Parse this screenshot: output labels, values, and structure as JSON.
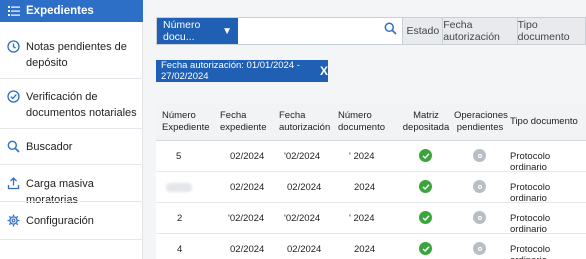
{
  "sidebar": {
    "active_label": "Expedientes",
    "items": [
      {
        "label": "Notas pendientes de depósito",
        "icon": "clock-icon"
      },
      {
        "label": "Verificación de documentos notariales",
        "icon": "check-circle-icon"
      },
      {
        "label": "Buscador",
        "icon": "search-icon"
      },
      {
        "label": "Carga masiva moratorias",
        "icon": "upload-icon"
      },
      {
        "label": "Configuración",
        "icon": "gear-icon"
      }
    ]
  },
  "filterbar": {
    "select_label": "Número docu...",
    "search_placeholder": "",
    "columns": [
      "Estado",
      "Fecha autorización",
      "Tipo documento"
    ]
  },
  "chip": {
    "label": "Fecha autorización: 01/01/2024 - 27/02/2024",
    "close": "X"
  },
  "table": {
    "headers": {
      "numero_expediente": "Número Expediente",
      "fecha_expediente": "Fecha expediente",
      "fecha_autorizacion": "Fecha autorización",
      "numero_documento": "Número documento",
      "matriz_depositada": "Matriz depositada",
      "operaciones_pendientes": "Operaciones pendientes",
      "tipo_documento": "Tipo documento"
    },
    "rows": [
      {
        "numero": "5",
        "fecha_exp": "02/2024",
        "fecha_aut": "'02/2024",
        "num_doc": "' 2024",
        "tipo": "Protocolo ordinario"
      },
      {
        "numero": "",
        "fecha_exp": "02/2024",
        "fecha_aut": "02/2024",
        "num_doc": "2024",
        "tipo": "Protocolo ordinario"
      },
      {
        "numero": "2",
        "fecha_exp": "'02/2024",
        "fecha_aut": "'02/2024",
        "num_doc": "' 2024",
        "tipo": "Protocolo ordinario"
      },
      {
        "numero": "4",
        "fecha_exp": "02/2024",
        "fecha_aut": "02/2024",
        "num_doc": "2024",
        "tipo": "Protocolo ordinario"
      }
    ]
  },
  "colors": {
    "accent": "#1f5fb4",
    "sidebar_active": "#2d6ec6",
    "ok": "#3aa53a",
    "pending": "#b9bec4"
  }
}
